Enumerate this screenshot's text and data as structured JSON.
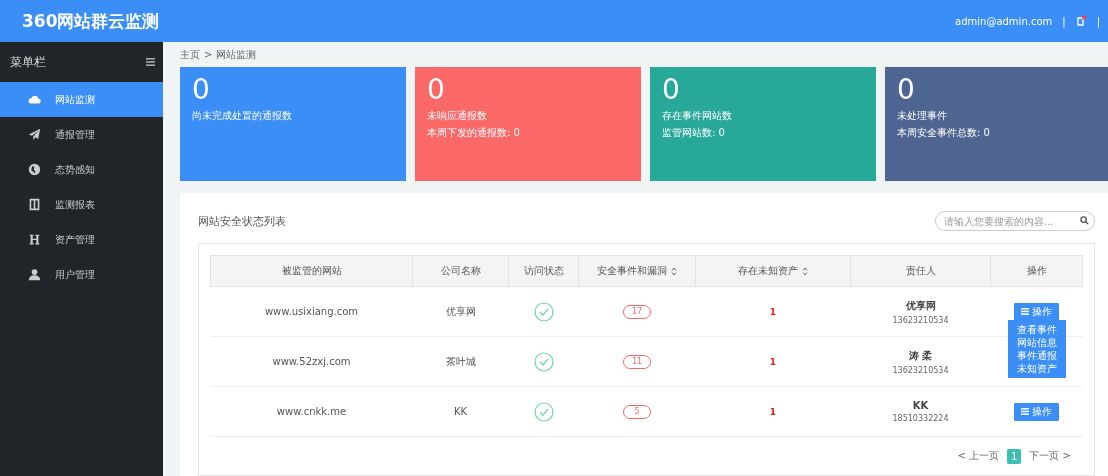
{
  "header": {
    "logo": "360网站群云监测",
    "user": "admin@admin.com",
    "separator": "|",
    "notification": true
  },
  "sidebar": {
    "title": "菜单栏",
    "items": [
      {
        "label": "网站监测",
        "selected": true
      },
      {
        "label": "通报管理",
        "selected": false
      },
      {
        "label": "态势感知",
        "selected": false
      },
      {
        "label": "监测报表",
        "selected": false
      },
      {
        "label": "资产管理",
        "selected": false
      },
      {
        "label": "用户管理",
        "selected": false
      }
    ]
  },
  "breadcrumb": [
    "主页",
    ">",
    "网站监测"
  ],
  "cards": [
    {
      "value": "0",
      "label": "尚未完成处置的通报数",
      "color": "#3a8ef6"
    },
    {
      "value": "0",
      "label": "未响应通报数",
      "sub": "本周下发的通报数: 0",
      "color": "#fa6868"
    },
    {
      "value": "0",
      "label": "存在事件网站数",
      "sub": "监管网站数: 0",
      "color": "#28a899"
    },
    {
      "value": "0",
      "label": "未处理事件",
      "sub": "本周安全事件总数: 0",
      "color": "#4f6591"
    }
  ],
  "panel": {
    "title": "网站安全状态列表",
    "search": {
      "placeholder": "请输入您要搜索的内容..."
    }
  },
  "table": {
    "columns": [
      {
        "label": "被监管的网站",
        "sortable": false
      },
      {
        "label": "公司名称",
        "sortable": false
      },
      {
        "label": "访问状态",
        "sortable": false
      },
      {
        "label": "安全事件和漏洞",
        "sortable": true
      },
      {
        "label": "存在未知资产",
        "sortable": true
      },
      {
        "label": "责任人",
        "sortable": false
      },
      {
        "label": "操作",
        "sortable": false
      }
    ],
    "rows": [
      {
        "site": "www.usixiang.com",
        "company": "优享网",
        "reachable": true,
        "events": "17",
        "unknown_assets": "1",
        "owner": "优享网",
        "phone": "13623210534",
        "action": "操作",
        "menu": [
          "查看事件",
          "网站信息",
          "事件通报",
          "未知资产"
        ]
      },
      {
        "site": "www.52zxj.com",
        "company": "茶叶城",
        "reachable": true,
        "events": "11",
        "unknown_assets": "1",
        "owner": "涛 柔",
        "phone": "13623210534"
      },
      {
        "site": "www.cnkk.me",
        "company": "KK",
        "reachable": true,
        "events": "5",
        "unknown_assets": "1",
        "owner": "KK",
        "phone": "18510332224",
        "action": "操作"
      }
    ]
  },
  "pagination": {
    "prev": "< 上一页",
    "pages": [
      {
        "label": "1",
        "selected": true
      }
    ],
    "next": "下一页 >"
  }
}
